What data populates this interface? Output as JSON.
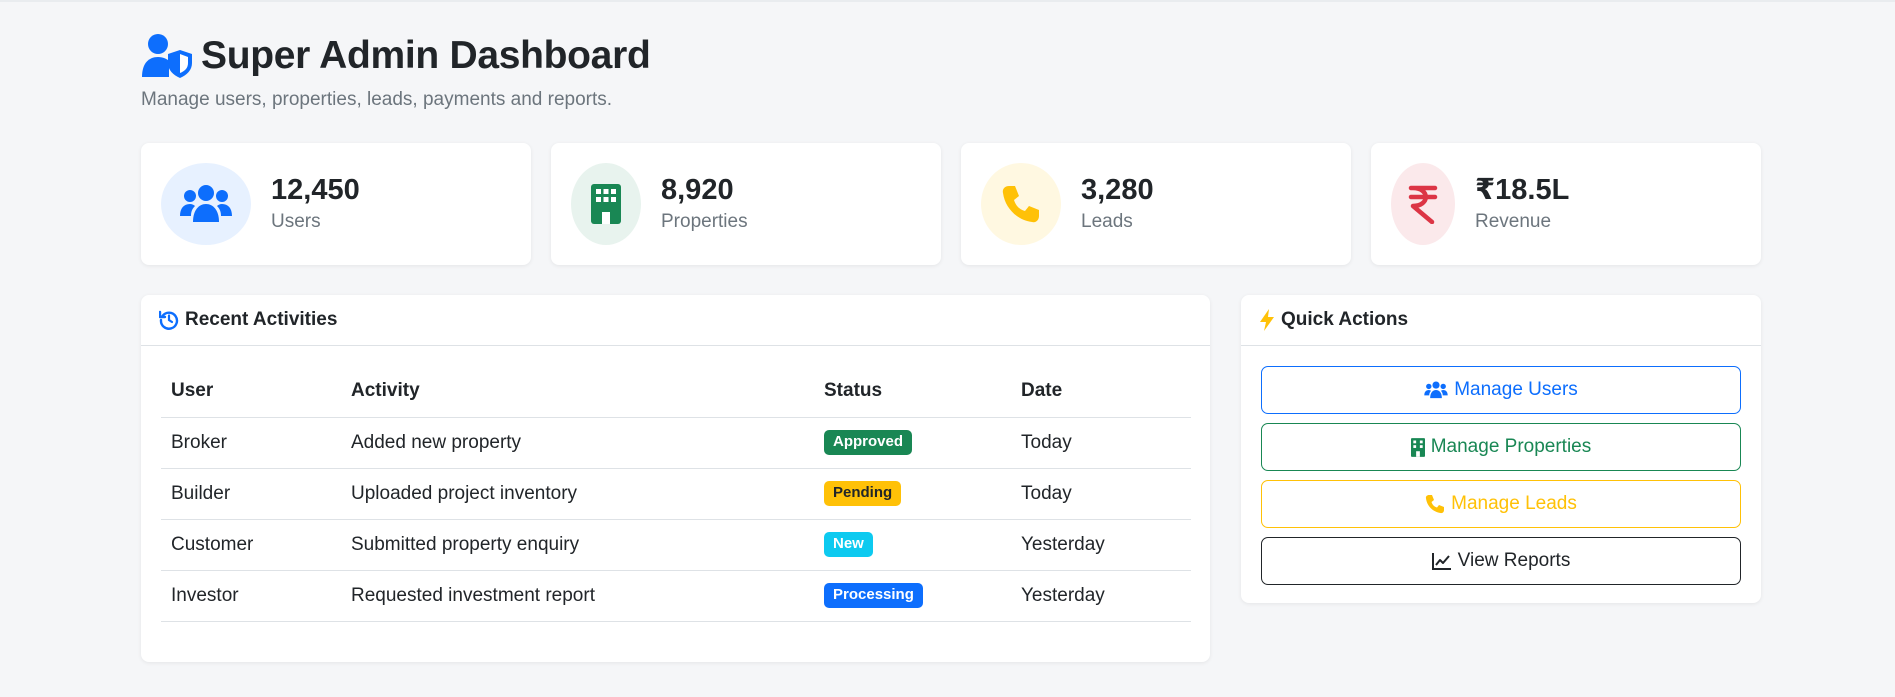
{
  "header": {
    "title": "Super Admin Dashboard",
    "subtitle": "Manage users, properties, leads, payments and reports.",
    "icon": "user-shield-icon"
  },
  "stats": [
    {
      "value": "12,450",
      "label": "Users",
      "icon": "users-icon",
      "color": "#0d6efd",
      "bg": "#e7f1ff"
    },
    {
      "value": "8,920",
      "label": "Properties",
      "icon": "building-icon",
      "color": "#198754",
      "bg": "#e8f3ee"
    },
    {
      "value": "3,280",
      "label": "Leads",
      "icon": "phone-icon",
      "color": "#ffc107",
      "bg": "#fff8e1"
    },
    {
      "value": "₹18.5L",
      "label": "Revenue",
      "icon": "rupee-icon",
      "color": "#dc3545",
      "bg": "#fbe9eb"
    }
  ],
  "activities": {
    "title": "Recent Activities",
    "icon": "history-icon",
    "columns": [
      "User",
      "Activity",
      "Status",
      "Date"
    ],
    "rows": [
      {
        "user": "Broker",
        "activity": "Added new property",
        "status": "Approved",
        "status_color": "#198754",
        "status_text_color": "#ffffff",
        "date": "Today"
      },
      {
        "user": "Builder",
        "activity": "Uploaded project inventory",
        "status": "Pending",
        "status_color": "#ffc107",
        "status_text_color": "#212529",
        "date": "Today"
      },
      {
        "user": "Customer",
        "activity": "Submitted property enquiry",
        "status": "New",
        "status_color": "#0dcaf0",
        "status_text_color": "#ffffff",
        "date": "Yesterday"
      },
      {
        "user": "Investor",
        "activity": "Requested investment report",
        "status": "Processing",
        "status_color": "#0d6efd",
        "status_text_color": "#ffffff",
        "date": "Yesterday"
      }
    ]
  },
  "quick_actions": {
    "title": "Quick Actions",
    "icon": "bolt-icon",
    "buttons": [
      {
        "label": "Manage Users",
        "icon": "users-icon",
        "color": "#0d6efd"
      },
      {
        "label": "Manage Properties",
        "icon": "building-icon",
        "color": "#198754"
      },
      {
        "label": "Manage Leads",
        "icon": "phone-icon",
        "color": "#ffc107"
      },
      {
        "label": "View Reports",
        "icon": "chart-line-icon",
        "color": "#212529"
      }
    ]
  }
}
